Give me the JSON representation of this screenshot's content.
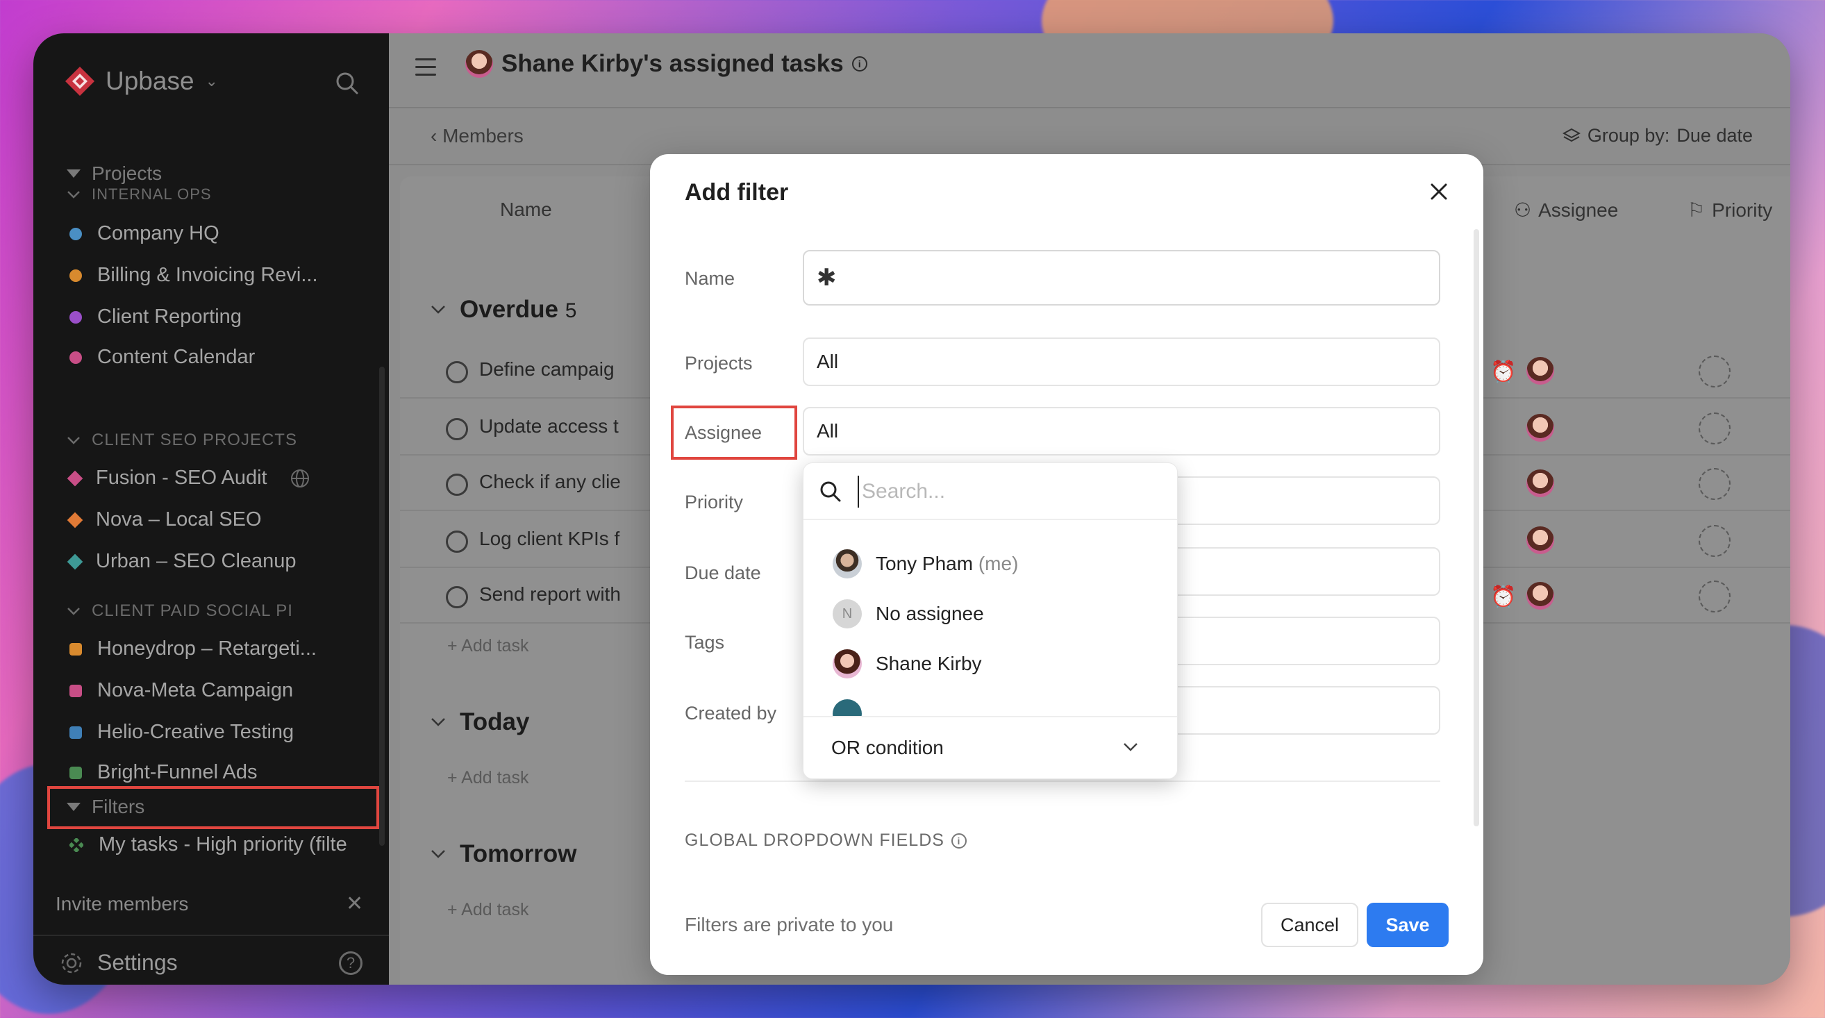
{
  "app": {
    "name": "Upbase"
  },
  "sidebar": {
    "projects_header": "Projects",
    "sections": [
      {
        "title": "INTERNAL OPS",
        "items": [
          {
            "label": "Company HQ",
            "color": "#4a8fc4",
            "shape": "dot"
          },
          {
            "label": "Billing & Invoicing Revi...",
            "color": "#d88a2e",
            "shape": "dot"
          },
          {
            "label": "Client Reporting",
            "color": "#9a4fc8",
            "shape": "dot"
          },
          {
            "label": "Content Calendar",
            "color": "#c84e86",
            "shape": "dot"
          }
        ]
      },
      {
        "title": "CLIENT SEO PROJECTS",
        "items": [
          {
            "label": "Fusion - SEO Audit",
            "color": "#c84e86",
            "shape": "diamond"
          },
          {
            "label": "Nova – Local SEO",
            "color": "#e07a36",
            "shape": "diamond"
          },
          {
            "label": "Urban – SEO Cleanup",
            "color": "#3e9a96",
            "shape": "diamond"
          }
        ]
      },
      {
        "title": "CLIENT PAID SOCIAL PI",
        "items": [
          {
            "label": "Honeydrop – Retargeti...",
            "color": "#d88a2e",
            "shape": "square"
          },
          {
            "label": "Nova-Meta Campaign",
            "color": "#c84e86",
            "shape": "square"
          },
          {
            "label": "Helio-Creative Testing",
            "color": "#3f7fb6",
            "shape": "square"
          },
          {
            "label": "Bright-Funnel Ads",
            "color": "#4a8a52",
            "shape": "square"
          }
        ]
      }
    ],
    "filters_header": "Filters",
    "filter_items": [
      {
        "label": "My tasks - High priority (filte"
      }
    ],
    "invite": "Invite members",
    "settings": "Settings"
  },
  "main": {
    "title": "Shane Kirby's assigned tasks",
    "back_label": "Members",
    "group_by_label": "Group by:",
    "group_by_value": "Due date",
    "columns": {
      "name": "Name",
      "assignee": "Assignee",
      "priority": "Priority"
    },
    "groups": [
      {
        "title": "Overdue",
        "count": "5"
      },
      {
        "title": "Today"
      },
      {
        "title": "Tomorrow"
      }
    ],
    "tasks": [
      "Define campaig",
      "Update access t",
      "Check if any clie",
      "Log client KPIs f",
      "Send report with"
    ],
    "add_task": "Add task"
  },
  "modal": {
    "title": "Add filter",
    "fields": {
      "name": {
        "label": "Name",
        "value": "✱"
      },
      "projects": {
        "label": "Projects",
        "value": "All"
      },
      "assignee": {
        "label": "Assignee",
        "value": "All"
      },
      "priority": {
        "label": "Priority"
      },
      "due_date": {
        "label": "Due date"
      },
      "tags": {
        "label": "Tags"
      },
      "created_by": {
        "label": "Created by"
      }
    },
    "global_section": "GLOBAL DROPDOWN FIELDS",
    "footer_note": "Filters are private to you",
    "cancel": "Cancel",
    "save": "Save"
  },
  "dropdown": {
    "search_placeholder": "Search...",
    "options": [
      {
        "name": "Tony Pham",
        "suffix": "(me)"
      },
      {
        "name": "No assignee",
        "initial": "N"
      },
      {
        "name": "Shane Kirby"
      }
    ],
    "condition": "OR condition"
  }
}
